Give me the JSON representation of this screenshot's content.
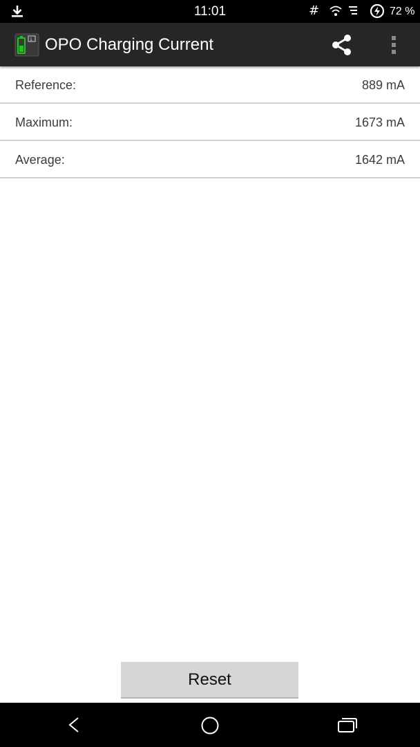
{
  "status_bar": {
    "time": "11:01",
    "network_symbol": "#",
    "battery_percent": "72 %",
    "icons": [
      "download-icon",
      "wifi-icon",
      "signal-icon",
      "battery-charging-icon"
    ]
  },
  "action_bar": {
    "title": "OPO Charging Current",
    "app_icon": "battery-app-icon",
    "actions": [
      "share-icon",
      "overflow-menu-icon"
    ]
  },
  "stats": [
    {
      "label": "Reference:",
      "value": "889 mA"
    },
    {
      "label": "Maximum:",
      "value": "1673 mA"
    },
    {
      "label": "Average:",
      "value": "1642 mA"
    }
  ],
  "reset_button": {
    "label": "Reset"
  },
  "nav_bar": {
    "icons": [
      "back-icon",
      "home-icon",
      "recents-icon"
    ]
  },
  "colors": {
    "status_bar_bg": "#000000",
    "action_bar_bg": "#262626",
    "divider": "#cfcfcf",
    "button_bg": "#d6d6d6",
    "battery_green": "#19c919"
  }
}
